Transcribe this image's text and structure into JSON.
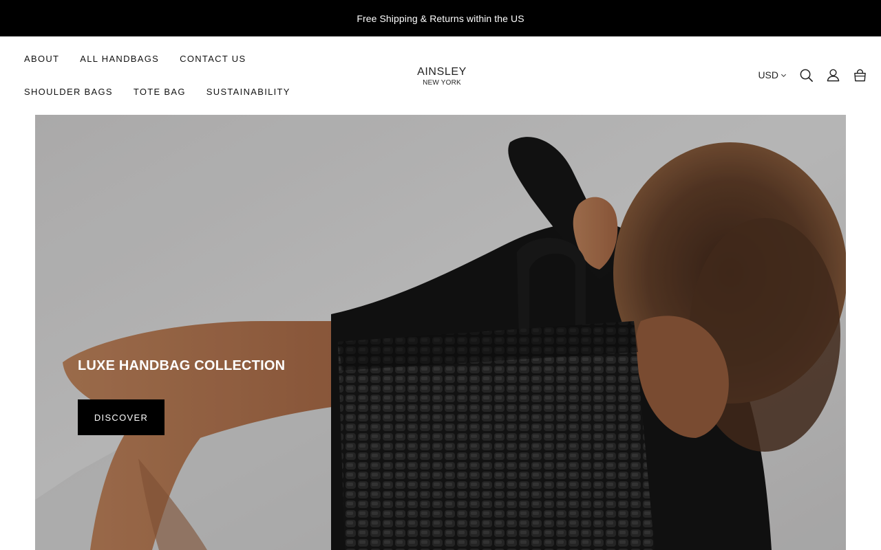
{
  "announcement": {
    "text": "Free Shipping & Returns within the US"
  },
  "nav": {
    "row1": [
      {
        "label": "ABOUT"
      },
      {
        "label": "ALL HANDBAGS"
      },
      {
        "label": "CONTACT US"
      }
    ],
    "row2": [
      {
        "label": "SHOULDER BAGS"
      },
      {
        "label": "TOTE BAG"
      },
      {
        "label": "SUSTAINABILITY"
      }
    ]
  },
  "logo": {
    "main": "AINSLEY",
    "sub": "NEW YORK"
  },
  "tools": {
    "currency": "USD",
    "icons": [
      "chevron-down-icon",
      "search-icon",
      "account-icon",
      "cart-icon"
    ]
  },
  "hero": {
    "heading": "LUXE HANDBAG COLLECTION",
    "button_label": "DISCOVER"
  },
  "colors": {
    "announcement_bg": "#000000",
    "announcement_text": "#ffffff",
    "button_bg": "#000000",
    "button_text": "#ffffff",
    "hero_backdrop": "#b9b8b8"
  }
}
